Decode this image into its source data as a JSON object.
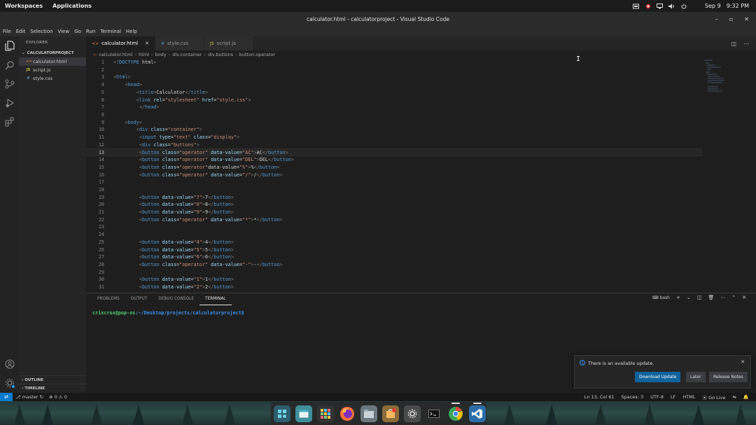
{
  "os_topbar": {
    "workspaces": "Workspaces",
    "applications": "Applications",
    "date": "Sep 9",
    "time": "9:32 PM"
  },
  "window": {
    "title": "calculator.html - calculatorproject - Visual Studio Code"
  },
  "menu": [
    "File",
    "Edit",
    "Selection",
    "View",
    "Go",
    "Run",
    "Terminal",
    "Help"
  ],
  "sidebar": {
    "title": "EXPLORER",
    "project": "CALCULATORPROJECT",
    "files": [
      {
        "name": "calculator.html",
        "badge": "<>",
        "badge_color": "#e37933",
        "selected": true
      },
      {
        "name": "script.js",
        "badge": "JS",
        "badge_color": "#cbcb41",
        "selected": false
      },
      {
        "name": "style.css",
        "badge": "#",
        "badge_color": "#519aba",
        "selected": false
      }
    ],
    "outline": "OUTLINE",
    "timeline": "TIMELINE"
  },
  "tabs": [
    {
      "label": "calculator.html",
      "icon": "<>",
      "icon_color": "#e37933",
      "active": true
    },
    {
      "label": "style.css",
      "icon": "#",
      "icon_color": "#519aba",
      "active": false
    },
    {
      "label": "script.js",
      "icon": "JS",
      "icon_color": "#cbcb41",
      "active": false
    }
  ],
  "breadcrumb": [
    "calculator.html",
    "html",
    "body",
    "div.container",
    "div.buttons",
    "button.operator"
  ],
  "editor": {
    "current_line": 13,
    "lines": [
      {
        "n": 1,
        "text": "<!DOCTYPE html>"
      },
      {
        "n": 2,
        "text": ""
      },
      {
        "n": 3,
        "text": "<html>"
      },
      {
        "n": 4,
        "text": "    <head>"
      },
      {
        "n": 5,
        "text": "        <title>Calculator</title>"
      },
      {
        "n": 6,
        "text": "        <link rel=\"stylesheet\" href=\"style.css\">"
      },
      {
        "n": 7,
        "text": "         </head>"
      },
      {
        "n": 8,
        "text": ""
      },
      {
        "n": 9,
        "text": "    <body>"
      },
      {
        "n": 10,
        "text": "        <div class=\"container\">"
      },
      {
        "n": 11,
        "text": "         <input type=\"text\" class=\"display\">"
      },
      {
        "n": 12,
        "text": "         <div class=\"buttons\">"
      },
      {
        "n": 13,
        "text": "         <button class=\"operator\" data-value=\"AC\">AC</button>"
      },
      {
        "n": 14,
        "text": "         <button class=\"operator\" data-value=\"DEL\">DEL</button>"
      },
      {
        "n": 15,
        "text": "         <button class=\"operator\"data-value=\"%\">%</button>"
      },
      {
        "n": 16,
        "text": "         <button class=\"operator\" data-value=\"/\">/</button>"
      },
      {
        "n": 17,
        "text": ""
      },
      {
        "n": 18,
        "text": ""
      },
      {
        "n": 19,
        "text": "         <button data-value=\"7\">7</button>"
      },
      {
        "n": 20,
        "text": "         <button data-value=\"8\">8</button>"
      },
      {
        "n": 21,
        "text": "         <button data-value=\"9\">9</button>"
      },
      {
        "n": 22,
        "text": "         <button class=\"operator\" data-value=\"*\">*</button>"
      },
      {
        "n": 23,
        "text": ""
      },
      {
        "n": 24,
        "text": ""
      },
      {
        "n": 25,
        "text": "         <button data-value=\"4\">4</button>"
      },
      {
        "n": 26,
        "text": "         <button data-value=\"5\">5</button>"
      },
      {
        "n": 27,
        "text": "         <button data-value=\"6\">6</button>"
      },
      {
        "n": 28,
        "text": "         <button class=\"operator\" data-value=\"-\">-</button>"
      },
      {
        "n": 29,
        "text": ""
      },
      {
        "n": 30,
        "text": "         <button data-value=\"1\">1</button>"
      },
      {
        "n": 31,
        "text": "         <button data-value=\"2\">2</button>"
      }
    ]
  },
  "panel": {
    "tabs": [
      "PROBLEMS",
      "OUTPUT",
      "DEBUG CONSOLE",
      "TERMINAL"
    ],
    "active_tab": "TERMINAL",
    "shell": "bash",
    "prompt_user": "crixcrox@pop-os",
    "prompt_path": ":~/Desktop/projects/calculatorproject$"
  },
  "notification": {
    "message": "There is an available update.",
    "primary": "Download Update",
    "later": "Later",
    "notes": "Release Notes"
  },
  "statusbar": {
    "branch": "master",
    "errors": "0",
    "warnings": "0",
    "position": "Ln 13, Col 61",
    "spaces": "Spaces: 3",
    "encoding": "UTF-8",
    "eol": "LF",
    "language": "HTML",
    "golive": "Go Live"
  },
  "colors": {
    "accent": "#0e639c",
    "statusbar_remote": "#0a7acc",
    "terminal_prompt": "#4ec96b"
  }
}
